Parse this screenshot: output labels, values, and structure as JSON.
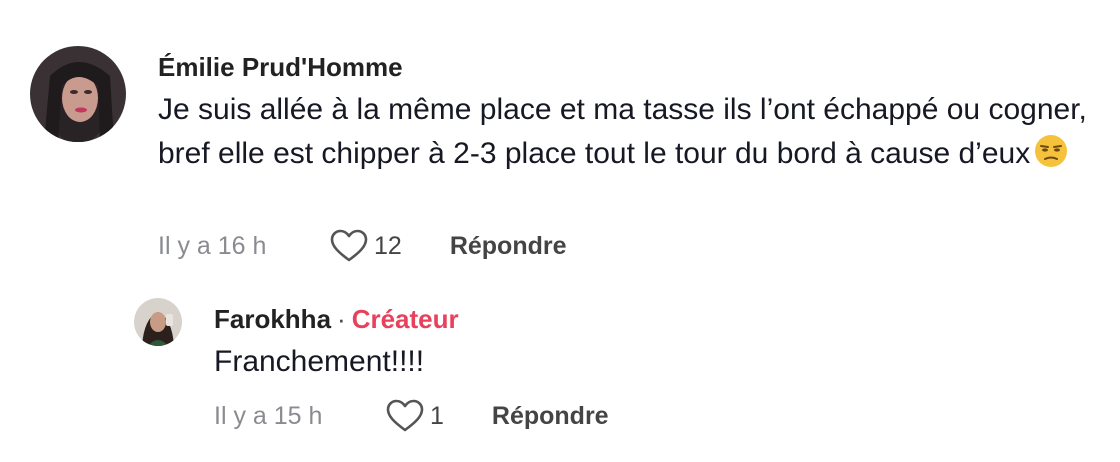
{
  "cut_off_text": "",
  "comments": [
    {
      "username": "Émilie Prud'Homme",
      "text": "Je suis allée à la même place et ma tasse ils l’ont échappé ou cogner, bref elle est chipper à 2-3 place tout le tour du bord à cause d’eux",
      "emoji": "unamused-face-emoji",
      "timestamp": "Il y a 16 h",
      "likes": "12",
      "reply_label": "Répondre"
    }
  ],
  "reply": {
    "username": "Farokhha",
    "separator": "·",
    "badge": "Créateur",
    "text": "Franchement!!!!",
    "timestamp": "Il y a 15 h",
    "likes": "1",
    "reply_label": "Répondre"
  },
  "colors": {
    "creator_badge": "#e8415c",
    "secondary_text": "#8a8b91",
    "primary_text": "#161823"
  },
  "icons": {
    "like": "heart-outline-icon"
  }
}
